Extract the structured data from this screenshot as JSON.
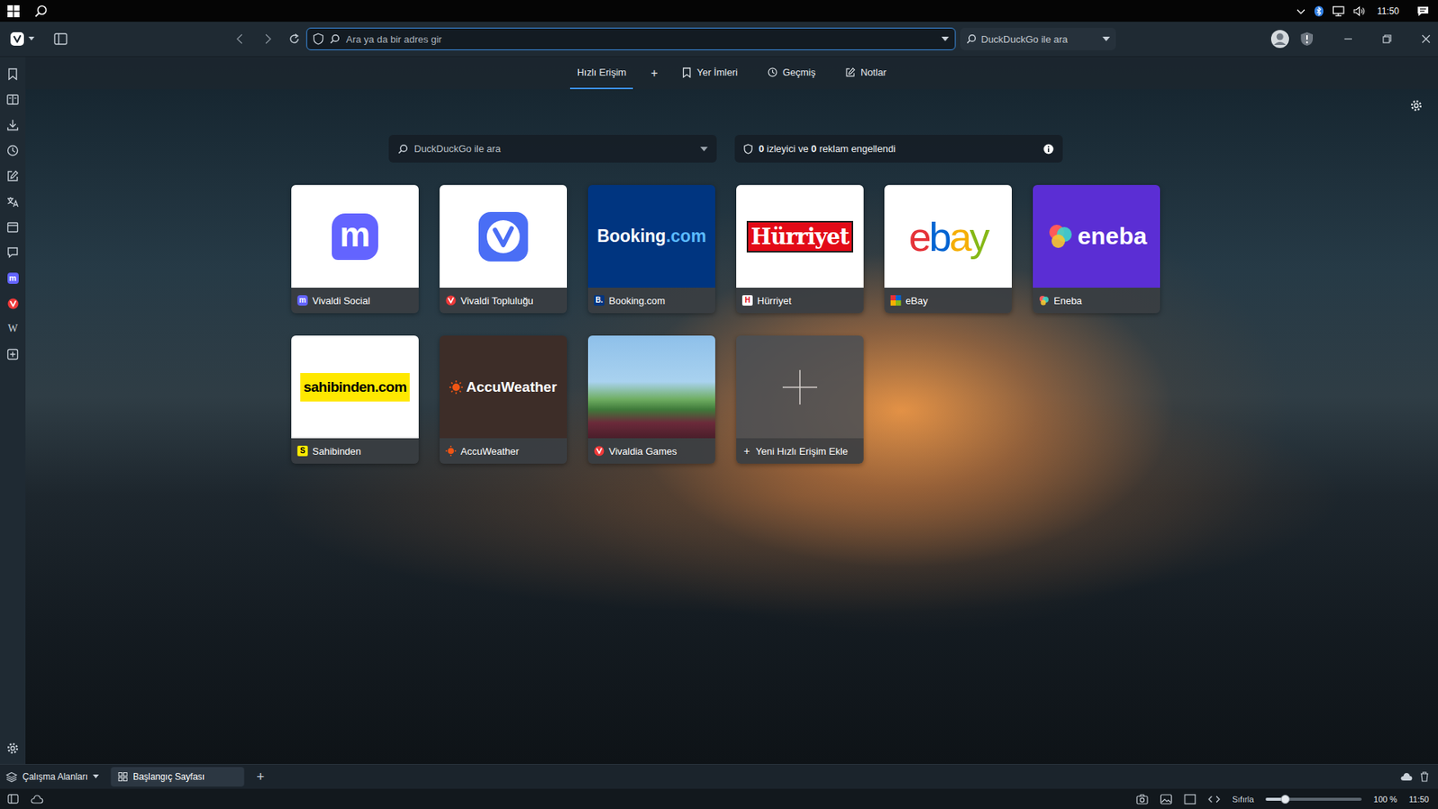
{
  "taskbar": {
    "time": "11:50"
  },
  "toolbar": {
    "address": {
      "placeholder": "Ara ya da bir adres gir"
    },
    "search": {
      "placeholder": "DuckDuckGo ile ara"
    }
  },
  "sidebar": {
    "items": [
      {
        "kind": "bookmarks"
      },
      {
        "kind": "reading"
      },
      {
        "kind": "downloads"
      },
      {
        "kind": "history"
      },
      {
        "kind": "notes"
      },
      {
        "kind": "translate"
      },
      {
        "kind": "calendar"
      },
      {
        "kind": "feeds"
      },
      {
        "kind": "mastodon",
        "text": "m"
      },
      {
        "kind": "vivaldi"
      },
      {
        "kind": "wikipedia",
        "text": "W"
      },
      {
        "kind": "add"
      }
    ]
  },
  "start_page": {
    "tabs": [
      {
        "label": "Hızlı Erişim",
        "kind": "tab",
        "selected": true
      },
      {
        "label": "+",
        "kind": "add",
        "selected": false
      },
      {
        "label": "Yer İmleri",
        "kind": "tab",
        "selected": false
      },
      {
        "label": "Geçmiş",
        "kind": "tab",
        "selected": false
      },
      {
        "label": "Notlar",
        "kind": "tab",
        "selected": false
      }
    ]
  },
  "search": {
    "placeholder": "DuckDuckGo ile ara"
  },
  "blocker": {
    "trackers": "0",
    "trackers_label": "izleyici ve",
    "ads": "0",
    "ads_label": "reklam engellendi"
  },
  "speed_dials": [
    {
      "title": "Vivaldi Social",
      "kind": "mastodon",
      "color": "#ffffff",
      "mark": "m",
      "favicon": {
        "kind": "mastodon",
        "text": "m"
      }
    },
    {
      "title": "Vivaldi Topluluğu",
      "kind": "vivaldi",
      "color": "#ffffff",
      "favicon": {
        "kind": "vivaldi"
      }
    },
    {
      "title": "Booking.com",
      "kind": "logo",
      "color": "#003580",
      "logo": [
        {
          "text": "Booking",
          "color": "#ffffff"
        },
        {
          "text": ".com",
          "color": "#5bbaff"
        }
      ],
      "favicon": {
        "kind": "letter",
        "text": "B.",
        "color": "#ffffff",
        "bg": "#003580"
      }
    },
    {
      "title": "Hürriyet",
      "kind": "logo",
      "color": "#ffffff",
      "logo": [
        {
          "text": "Hürriyet",
          "color": "#ffffff",
          "bg": "#e30a17"
        }
      ],
      "favicon": {
        "kind": "letter",
        "text": "H",
        "color": "#e30a17",
        "bg": "#ffffff"
      }
    },
    {
      "title": "eBay",
      "kind": "logo",
      "color": "#ffffff",
      "logo": [
        {
          "text": "e",
          "color": "#e53238"
        },
        {
          "text": "b",
          "color": "#0064d2"
        },
        {
          "text": "a",
          "color": "#f5af02"
        },
        {
          "text": "y",
          "color": "#86b817"
        }
      ],
      "favicon": {
        "kind": "ebay"
      }
    },
    {
      "title": "Eneba",
      "kind": "logo",
      "color": "#5b2ed4",
      "emblem": "eneba",
      "logo": [
        {
          "text": "eneba",
          "color": "#ffffff"
        }
      ],
      "favicon": {
        "kind": "eneba"
      }
    },
    {
      "title": "Sahibinden",
      "kind": "logo",
      "color": "#ffffff",
      "logo": [
        {
          "text": "sahibinden.com",
          "color": "#000000",
          "bg": "#ffe800"
        }
      ],
      "favicon": {
        "kind": "letter",
        "text": "S",
        "color": "#000000",
        "bg": "#ffe800"
      }
    },
    {
      "title": "AccuWeather",
      "kind": "logo",
      "color": "#3d2d28",
      "emblem": "accuweather",
      "logo": [
        {
          "text": "AccuWeather",
          "color": "#ffffff"
        }
      ],
      "favicon": {
        "kind": "accuweather"
      }
    },
    {
      "title": "Vivaldia Games",
      "kind": "game",
      "color": "#7fb0dc",
      "favicon": {
        "kind": "vivaldi"
      }
    },
    {
      "title": "Yeni Hızlı Erişim Ekle",
      "kind": "add",
      "color": "#4a4f55",
      "favicon": {
        "kind": "plus",
        "text": "+"
      }
    }
  ],
  "tab_bar": {
    "workspaces": "Çalışma Alanları",
    "tabs": [
      {
        "label": "Başlangıç Sayfası",
        "selected": true
      }
    ],
    "new_tab": "+"
  },
  "status_bar": {
    "zoom_reset": "Sıfırla",
    "zoom_level": 0.2,
    "zoom_reading": "100 %",
    "time": "11:50"
  }
}
